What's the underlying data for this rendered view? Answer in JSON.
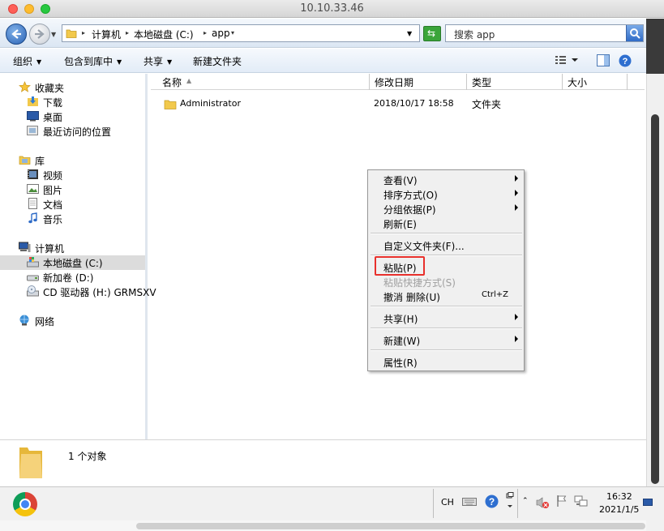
{
  "window": {
    "title": "10.10.33.46"
  },
  "address": {
    "crumbs": [
      "计算机",
      "本地磁盘 (C:)",
      "app"
    ],
    "search_placeholder": "搜索 app"
  },
  "toolbar": {
    "organize": "组织",
    "include_in_library": "包含到库中",
    "share": "共享",
    "new_folder": "新建文件夹"
  },
  "nav": {
    "favorites": "收藏夹",
    "downloads": "下载",
    "desktop": "桌面",
    "recent": "最近访问的位置",
    "libraries": "库",
    "videos": "视频",
    "pictures": "图片",
    "documents": "文档",
    "music": "音乐",
    "computer": "计算机",
    "local_disk": "本地磁盘 (C:)",
    "new_volume": "新加卷 (D:)",
    "cd_drive": "CD 驱动器 (H:) GRMSXV",
    "network": "网络"
  },
  "columns": {
    "name": "名称",
    "modified": "修改日期",
    "type": "类型",
    "size": "大小"
  },
  "files": [
    {
      "name": "Administrator",
      "modified": "2018/10/17 18:58",
      "type": "文件夹",
      "size": ""
    }
  ],
  "context_menu": {
    "view": "查看(V)",
    "sort_by": "排序方式(O)",
    "group_by": "分组依据(P)",
    "refresh": "刷新(E)",
    "customize_folder": "自定义文件夹(F)...",
    "paste": "粘贴(P)",
    "paste_shortcut": "粘贴快捷方式(S)",
    "undo_delete": "撤消 删除(U)",
    "undo_shortcut": "Ctrl+Z",
    "share_with": "共享(H)",
    "new": "新建(W)",
    "properties": "属性(R)"
  },
  "status": {
    "count": "1 个对象"
  },
  "taskbar": {
    "lang": "CH",
    "time": "16:32",
    "date": "2021/1/5"
  },
  "colors": {
    "highlight_box": "#e8302c",
    "folder": "#f2c94c"
  }
}
